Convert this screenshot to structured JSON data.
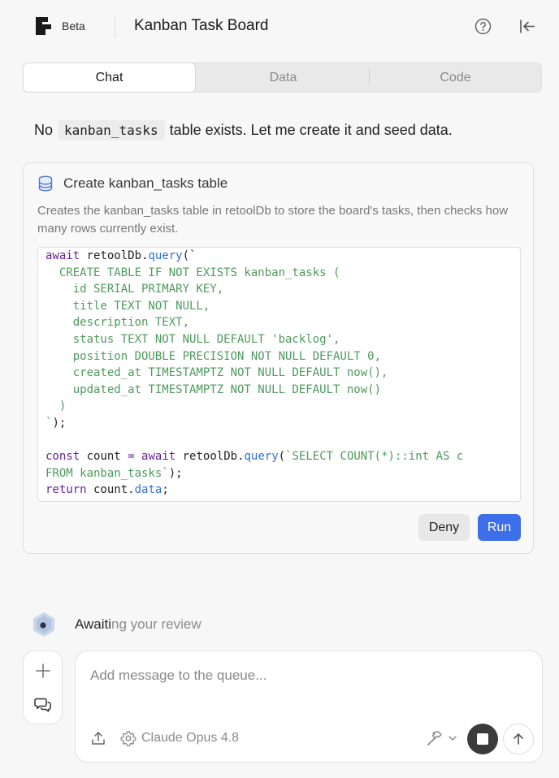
{
  "header": {
    "beta_label": "Beta",
    "title": "Kanban Task Board",
    "icons": [
      "logo-icon",
      "help-icon",
      "collapse-sidebar-icon"
    ]
  },
  "tabs": [
    {
      "label": "Chat",
      "active": true
    },
    {
      "label": "Data",
      "active": false
    },
    {
      "label": "Code",
      "active": false
    }
  ],
  "message": {
    "prefix": "No",
    "code": "kanban_tasks",
    "suffix": "table exists. Let me create it and seed data."
  },
  "tool_card": {
    "icon": "database-icon",
    "title": "Create kanban_tasks table",
    "description": "Creates the kanban_tasks table in retoolDb to store the board's tasks, then checks how many rows currently exist.",
    "code_lines": [
      [
        {
          "t": "await",
          "c": "kw"
        },
        {
          "t": " retoolDb.",
          "c": "pl"
        },
        {
          "t": "query",
          "c": "fn"
        },
        {
          "t": "(`",
          "c": "pl"
        }
      ],
      [
        {
          "t": "  CREATE TABLE IF NOT EXISTS kanban_tasks (",
          "c": "st"
        }
      ],
      [
        {
          "t": "    id SERIAL PRIMARY KEY,",
          "c": "st"
        }
      ],
      [
        {
          "t": "    title TEXT NOT NULL,",
          "c": "st"
        }
      ],
      [
        {
          "t": "    description TEXT,",
          "c": "st"
        }
      ],
      [
        {
          "t": "    status TEXT NOT NULL DEFAULT 'backlog',",
          "c": "st"
        }
      ],
      [
        {
          "t": "    position DOUBLE PRECISION NOT NULL DEFAULT 0,",
          "c": "st"
        }
      ],
      [
        {
          "t": "    created_at TIMESTAMPTZ NOT NULL DEFAULT now(),",
          "c": "st"
        }
      ],
      [
        {
          "t": "    updated_at TIMESTAMPTZ NOT NULL DEFAULT now()",
          "c": "st"
        }
      ],
      [
        {
          "t": "  )",
          "c": "st"
        }
      ],
      [
        {
          "t": "`",
          "c": "st"
        },
        {
          "t": ");",
          "c": "pl"
        }
      ],
      [
        {
          "t": "",
          "c": "pl"
        }
      ],
      [
        {
          "t": "const",
          "c": "kw"
        },
        {
          "t": " count ",
          "c": "pl"
        },
        {
          "t": "=",
          "c": "kw"
        },
        {
          "t": " ",
          "c": "pl"
        },
        {
          "t": "await",
          "c": "kw"
        },
        {
          "t": " retoolDb.",
          "c": "pl"
        },
        {
          "t": "query",
          "c": "fn"
        },
        {
          "t": "(",
          "c": "pl"
        },
        {
          "t": "`SELECT COUNT(*)::int AS c",
          "c": "st"
        }
      ],
      [
        {
          "t": "FROM kanban_tasks`",
          "c": "st"
        },
        {
          "t": ");",
          "c": "pl"
        }
      ],
      [
        {
          "t": "return",
          "c": "kw"
        },
        {
          "t": " count.",
          "c": "pl"
        },
        {
          "t": "data",
          "c": "fn"
        },
        {
          "t": ";",
          "c": "pl"
        }
      ]
    ],
    "deny_label": "Deny",
    "run_label": "Run"
  },
  "status": {
    "text_a": "Awaiti",
    "text_b": "ng your review"
  },
  "composer": {
    "placeholder": "Add message to the queue...",
    "value": "",
    "model_label": "Claude Opus 4.8"
  },
  "colors": {
    "accent": "#3c6fe8",
    "keyword": "#6a1f9a",
    "function": "#2f6fd6",
    "string": "#4e9a5c"
  }
}
